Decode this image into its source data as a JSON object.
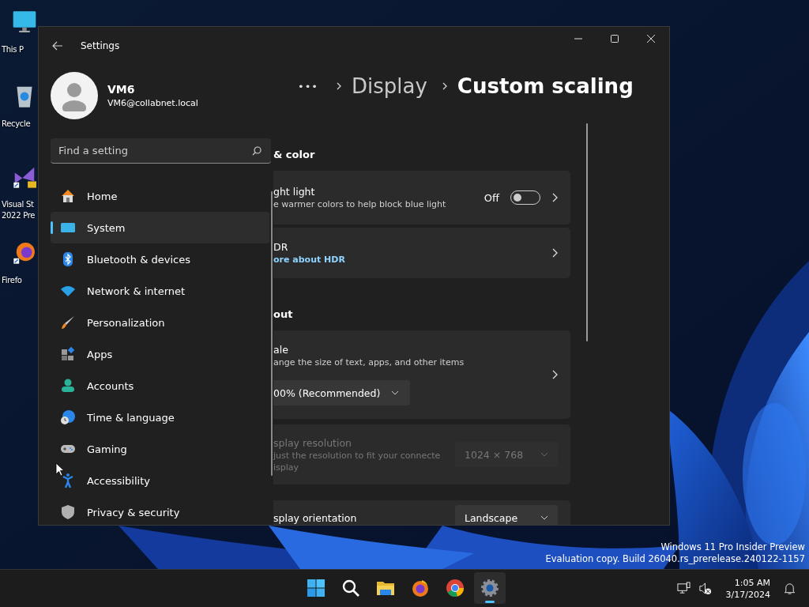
{
  "desktop": {
    "icons": [
      {
        "kind": "monitor",
        "lines": [
          "This P"
        ]
      },
      {
        "kind": "recycle",
        "lines": [
          "Recycle"
        ]
      },
      {
        "kind": "studio",
        "lines": [
          "Visual St",
          "2022 Pre"
        ]
      },
      {
        "kind": "firefox",
        "lines": [
          "Firefo"
        ]
      }
    ]
  },
  "window": {
    "title": "Settings"
  },
  "account": {
    "name": "VM6",
    "email": "VM6@collabnet.local"
  },
  "search": {
    "placeholder": "Find a setting"
  },
  "nav": [
    {
      "kind": "home",
      "label": "Home",
      "selected": false
    },
    {
      "kind": "system",
      "label": "System",
      "selected": true
    },
    {
      "kind": "bluetooth",
      "label": "Bluetooth & devices",
      "selected": false
    },
    {
      "kind": "network",
      "label": "Network & internet",
      "selected": false
    },
    {
      "kind": "personalization",
      "label": "Personalization",
      "selected": false
    },
    {
      "kind": "apps",
      "label": "Apps",
      "selected": false
    },
    {
      "kind": "accounts",
      "label": "Accounts",
      "selected": false
    },
    {
      "kind": "time",
      "label": "Time & language",
      "selected": false
    },
    {
      "kind": "gaming",
      "label": "Gaming",
      "selected": false
    },
    {
      "kind": "accessibility",
      "label": "Accessibility",
      "selected": false
    },
    {
      "kind": "privacy",
      "label": "Privacy & security",
      "selected": false
    }
  ],
  "breadcrumb": {
    "overflow": "•••",
    "items": [
      {
        "label": "Display",
        "selected": false
      },
      {
        "label": "Custom scaling",
        "selected": true
      }
    ]
  },
  "sections": [
    {
      "heading": "& color",
      "cards": [
        {
          "kind": "toggle",
          "title": "ght light",
          "subtitle": "e warmer colors to help block blue light",
          "state_label": "Off",
          "on": false,
          "chevron": true
        },
        {
          "kind": "link",
          "title": "DR",
          "link": "ore about HDR",
          "chevron": true
        }
      ]
    },
    {
      "heading": "out",
      "cards": [
        {
          "kind": "scale",
          "title": "ale",
          "subtitle": "ange the size of text, apps, and other items",
          "value": "00% (Recommended)",
          "chevron": true
        },
        {
          "kind": "dropdown",
          "title": "splay resolution",
          "subtitle_lines": [
            "just the resolution to fit your connecte",
            "isplay"
          ],
          "value": "1024 × 768",
          "disabled": true,
          "chevron": false
        },
        {
          "kind": "dropdown",
          "title": "splay orientation",
          "value": "Landscape",
          "disabled": false,
          "chevron": false
        }
      ]
    }
  ],
  "watermark": [
    "Windows 11 Pro Insider Preview",
    "Evaluation copy. Build 26040.rs_prerelease.240122-1157"
  ],
  "taskbar": {
    "apps": [
      {
        "kind": "start",
        "selected": false
      },
      {
        "kind": "search",
        "selected": false
      },
      {
        "kind": "folder",
        "selected": false
      },
      {
        "kind": "firefox",
        "selected": false
      },
      {
        "kind": "chrome",
        "selected": false
      },
      {
        "kind": "settings",
        "selected": true
      }
    ],
    "time": "1:05 AM",
    "date": "3/17/2024"
  }
}
